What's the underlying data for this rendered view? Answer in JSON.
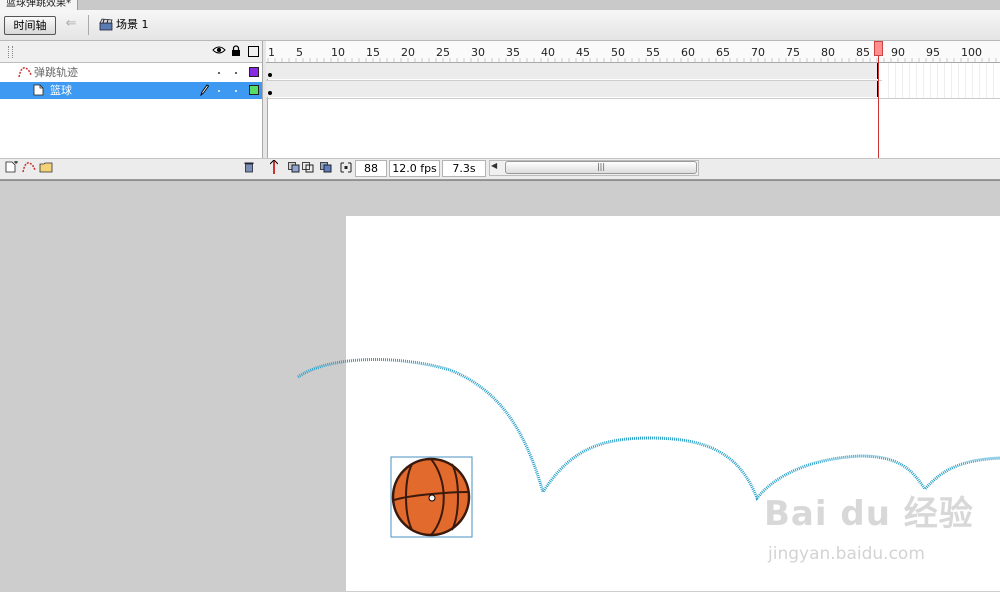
{
  "document": {
    "tab_title": "篮球弹跳效果*"
  },
  "toolbar": {
    "timeline_label": "时间轴",
    "back_icon": "back-arrow-icon",
    "scene_label": "场景 1"
  },
  "layers": [
    {
      "name": "弹跳轨迹",
      "icon": "motion-guide-icon",
      "color": "#8a2be2",
      "selected": false
    },
    {
      "name": "篮球",
      "icon": "layer-page-icon",
      "color": "#55dd66",
      "selected": true
    }
  ],
  "ruler": {
    "ticks": [
      "1",
      "5",
      "10",
      "15",
      "20",
      "25",
      "30",
      "35",
      "40",
      "45",
      "50",
      "55",
      "60",
      "65",
      "70",
      "75",
      "80",
      "85",
      "90",
      "95",
      "100"
    ]
  },
  "status": {
    "current_frame": "88",
    "frame_rate": "12.0 fps",
    "elapsed": "7.3s"
  },
  "watermark": {
    "logo": "Bai du 经验",
    "url": "jingyan.baidu.com"
  },
  "colors": {
    "selected_layer": "#3d99f2",
    "path": "#2aa0c8",
    "playhead": "#ff8f8f",
    "ball": "#e26a2c"
  }
}
